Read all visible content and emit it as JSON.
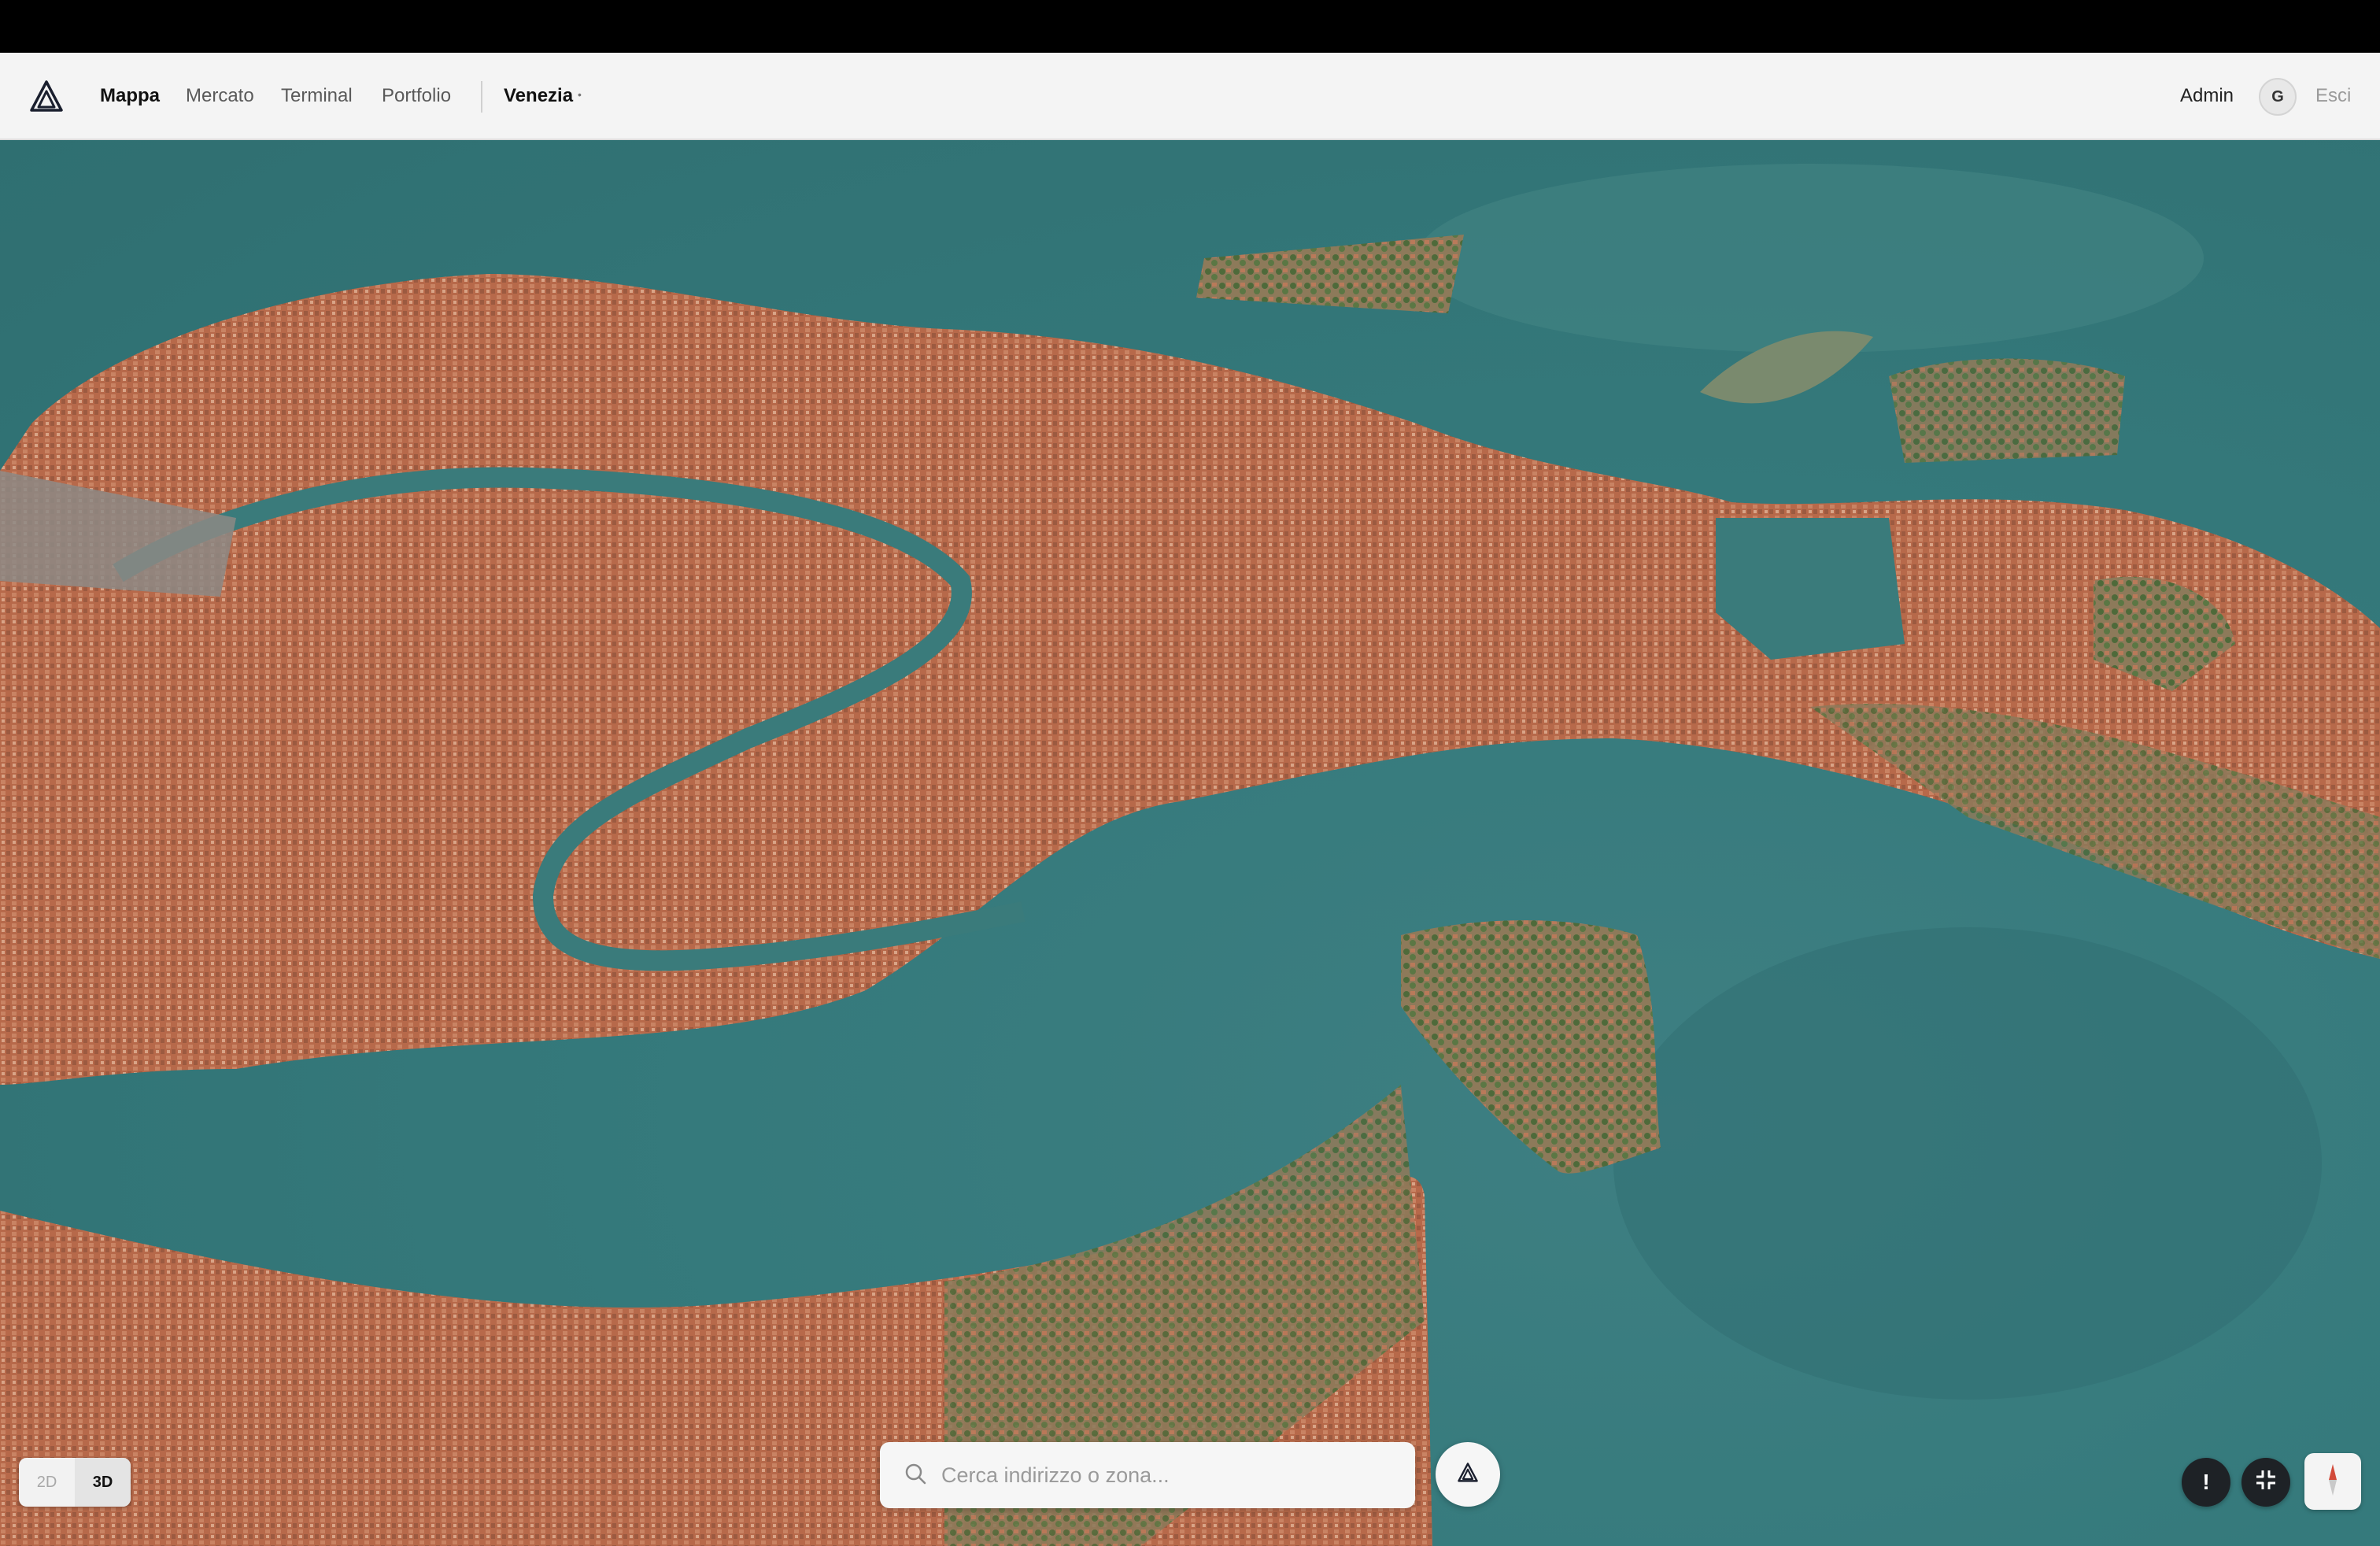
{
  "nav": {
    "links": [
      "Mappa",
      "Mercato",
      "Terminal",
      "Portfolio"
    ],
    "active": "Mappa",
    "city": "Venezia",
    "user": "Admin",
    "avatar_initial": "G",
    "logout": "Esci"
  },
  "map": {
    "view": "3d-satellite",
    "location": "Venezia",
    "water_color": "#357a7c",
    "land_color": "#b06a4a"
  },
  "mode_toggle": {
    "options": [
      "2D",
      "3D"
    ],
    "selected": "3D"
  },
  "search": {
    "placeholder": "Cerca indirizzo o zona...",
    "value": ""
  },
  "controls": {
    "alert_label": "!",
    "icons": [
      "search-icon",
      "logo-icon",
      "alert-icon",
      "exit-fullscreen-icon",
      "compass-icon"
    ]
  }
}
